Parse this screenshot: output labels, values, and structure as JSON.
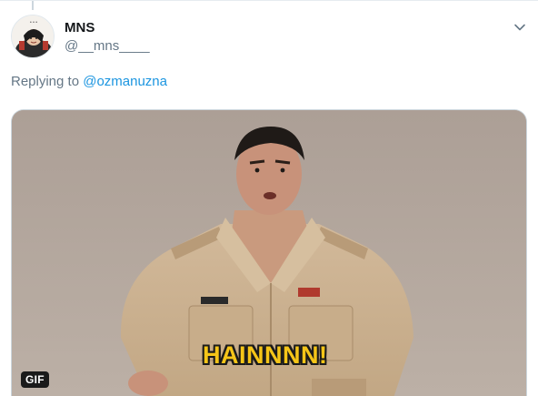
{
  "tweet": {
    "display_name": "MNS",
    "handle": "@__mns____",
    "replying_prefix": "Replying to ",
    "replying_to": "@ozmanuzna",
    "media": {
      "badge": "GIF",
      "caption": "HAINNNN!"
    }
  },
  "icons": {
    "caret": "chevron-down-icon",
    "avatar": "avatar-image"
  },
  "colors": {
    "link": "#1b95e0",
    "muted": "#657786",
    "text": "#14171a",
    "caption": "#f5c518"
  }
}
